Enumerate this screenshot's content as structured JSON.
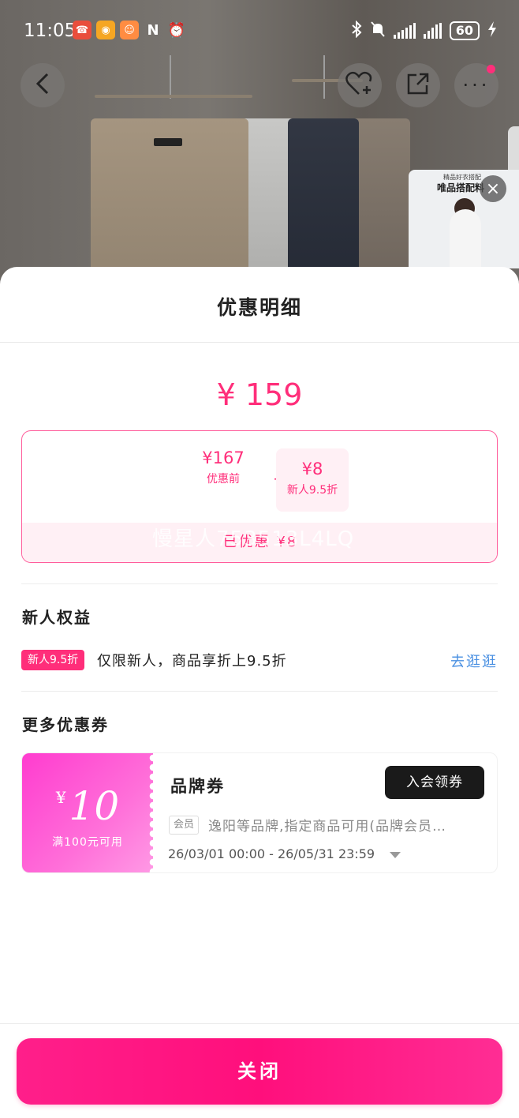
{
  "status_bar": {
    "time": "11:05",
    "battery": "60"
  },
  "header": {
    "back_icon": "chevron-left-icon",
    "favorite_icon": "heart-plus-icon",
    "share_icon": "share-icon",
    "more_icon": "more-dots-icon"
  },
  "mini_ad": {
    "title": "唯品搭配料",
    "subtitle": "精品好衣搭配",
    "close": "×"
  },
  "sheet": {
    "title": "优惠明细",
    "final_price": "¥ 159",
    "breakdown": {
      "before_amount": "¥167",
      "before_label": "优惠前",
      "minus": "−",
      "discount_amount": "¥8",
      "discount_label": "新人9.5折",
      "total_saved": "已优惠  ¥8",
      "watermark": "慢星人753513L4LQ"
    },
    "newbie": {
      "section_title": "新人权益",
      "tag": "新人9.5折",
      "description": "仅限新人，商品享折上9.5折",
      "link": "去逛逛"
    },
    "coupons": {
      "section_title": "更多优惠券",
      "items": [
        {
          "currency": "¥",
          "amount": "10",
          "condition": "满100元可用",
          "name": "品牌券",
          "button": "入会领券",
          "badge": "会员",
          "description": "逸阳等品牌,指定商品可用(品牌会员…",
          "validity": "26/03/01 00:00 - 26/05/31 23:59"
        }
      ]
    },
    "close_button": "关闭"
  },
  "colors": {
    "accent": "#ff2e7a",
    "link": "#4a90e2",
    "coupon_gradient_start": "#ff3ccf",
    "dark_button": "#1a1a1a"
  }
}
